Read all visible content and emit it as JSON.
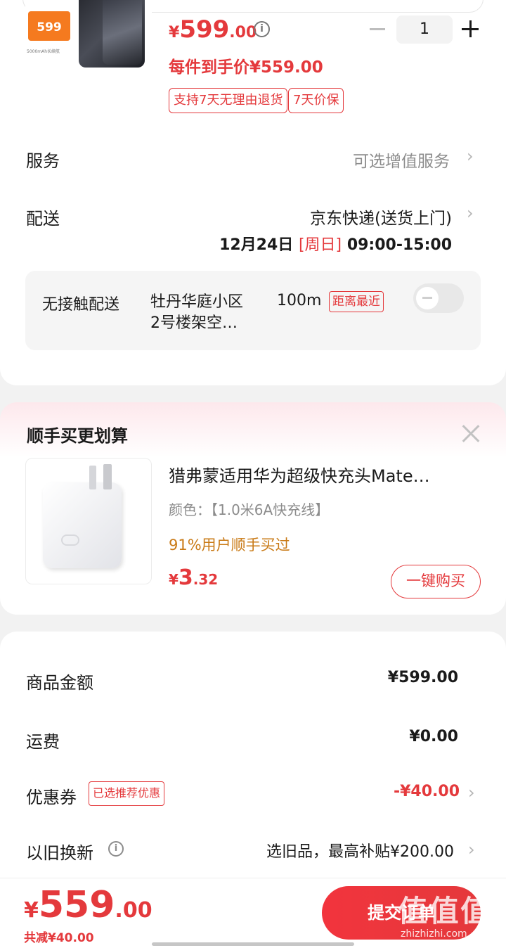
{
  "product": {
    "thumb_badge": "599",
    "thumb_caption": "5000mAh长续航",
    "price_symbol": "¥",
    "price_int": "599",
    "price_dec": ".00",
    "final_price_label": "每件到手价¥559.00",
    "quantity": "1",
    "tags": [
      "支持7天无理由退货",
      "7天价保"
    ]
  },
  "service": {
    "label": "服务",
    "value": "可选增值服务"
  },
  "delivery": {
    "label": "配送",
    "carrier": "京东快递(送货上门)",
    "date": "12月24日",
    "weekday": "[周日]",
    "time": "09:00-15:00",
    "contactless": {
      "label": "无接触配送",
      "place_line1": "牡丹华庭小区",
      "place_line2": "2号楼架空…",
      "distance": "100m",
      "badge": "距离最近"
    }
  },
  "upsell": {
    "title": "顺手买更划算",
    "product_name": "猎弗蒙适用华为超级快充头Mate…",
    "color": "颜色：【1.0米6A快充线】",
    "popularity": "91%用户顺手买过",
    "price_symbol": "¥",
    "price_int": "3",
    "price_dec": ".32",
    "buy_button": "一键购买"
  },
  "summary": {
    "goods_amount_label": "商品金额",
    "goods_amount": "¥599.00",
    "shipping_label": "运费",
    "shipping": "¥0.00",
    "coupon_label": "优惠券",
    "coupon_badge": "已选推荐优惠",
    "coupon_value": "-¥40.00",
    "tradein_label": "以旧换新",
    "tradein_value": "选旧品，最高补贴¥200.00"
  },
  "footer": {
    "total_symbol": "¥",
    "total_int": "559",
    "total_dec": ".00",
    "savings": "共减¥40.00",
    "submit": "提交订单",
    "watermark": "值 值 值",
    "watermark_url": "zhizhizhi.com"
  },
  "colors": {
    "accent": "#e4393c",
    "gold": "#c97a16"
  }
}
